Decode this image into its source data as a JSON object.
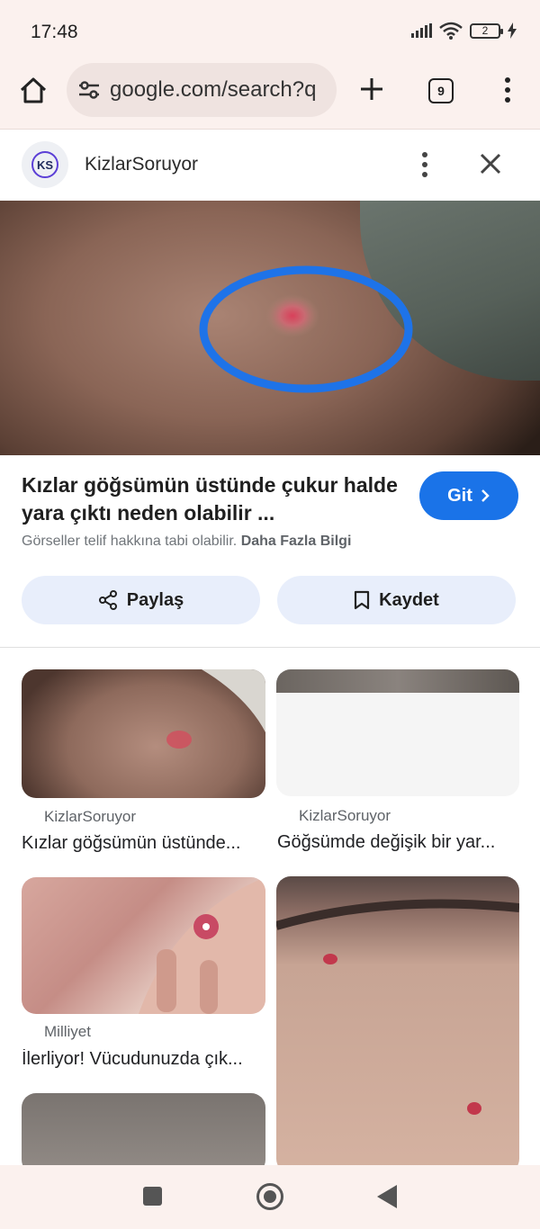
{
  "status_bar": {
    "time": "17:48",
    "battery": "2",
    "icons": [
      "signal-icon",
      "wifi-icon",
      "battery-icon",
      "charging-icon"
    ]
  },
  "browser": {
    "url": "google.com/search?q",
    "tab_count": "9",
    "icons": [
      "home-icon",
      "tune-icon",
      "plus-icon",
      "tabs-icon",
      "more-vert-icon"
    ]
  },
  "panel": {
    "site_name": "KizlarSoruyor",
    "logo_text": "KS",
    "result_title": "Kızlar göğsümün üstünde çukur halde yara çıktı neden olabilir ...",
    "go_button": "Git",
    "copyright_text": "Görseller telif hakkına tabi olabilir.",
    "more_info": "Daha Fazla Bilgi",
    "share_label": "Paylaş",
    "save_label": "Kaydet"
  },
  "related": [
    {
      "source": "KizlarSoruyor",
      "title": "Kızlar göğsümün üstünde..."
    },
    {
      "source": "KizlarSoruyor",
      "title": "Göğsümde değişik bir yar..."
    },
    {
      "source": "Milliyet",
      "title": "İlerliyor! Vücudunuzda çık..."
    }
  ],
  "colors": {
    "accent": "#1a73e8",
    "circle_highlight": "#1e73e8",
    "chrome_bg": "#fbf1ee"
  }
}
